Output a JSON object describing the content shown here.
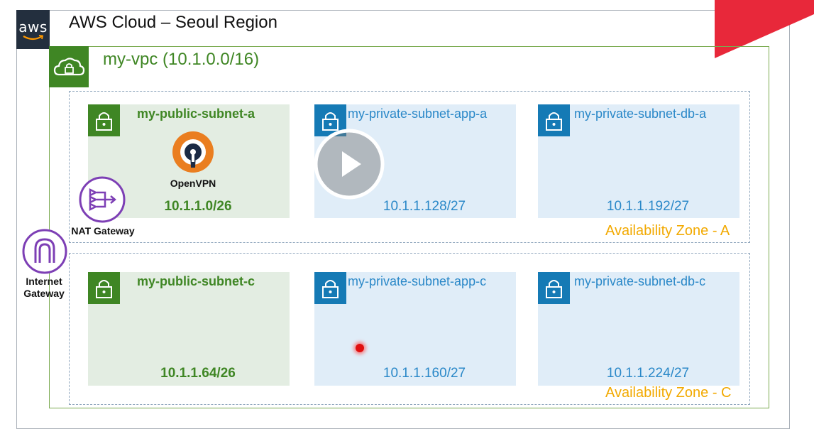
{
  "cloud": {
    "title": "AWS Cloud – Seoul Region",
    "logo_text": "aws"
  },
  "vpc": {
    "title": "my-vpc (10.1.0.0/16)"
  },
  "zones": [
    {
      "label": "Availability Zone - A"
    },
    {
      "label": "Availability Zone - C"
    }
  ],
  "subnets": [
    {
      "name": "my-public-subnet-a",
      "cidr": "10.1.1.0/26"
    },
    {
      "name": "my-private-subnet-app-a",
      "cidr": "10.1.1.128/27"
    },
    {
      "name": "my-private-subnet-db-a",
      "cidr": "10.1.1.192/27"
    },
    {
      "name": "my-public-subnet-c",
      "cidr": "10.1.1.64/26"
    },
    {
      "name": "my-private-subnet-app-c",
      "cidr": "10.1.1.160/27"
    },
    {
      "name": "my-private-subnet-db-c",
      "cidr": "10.1.1.224/27"
    }
  ],
  "components": {
    "openvpn": "OpenVPN",
    "nat_gateway": "NAT Gateway",
    "internet_gateway": [
      "Internet",
      "Gateway"
    ]
  },
  "colors": {
    "public": "#3f8624",
    "private": "#157ab5",
    "zone_label": "#f2a900",
    "aws_dark": "#232f3e",
    "gateway_purple": "#7d3fb5"
  }
}
